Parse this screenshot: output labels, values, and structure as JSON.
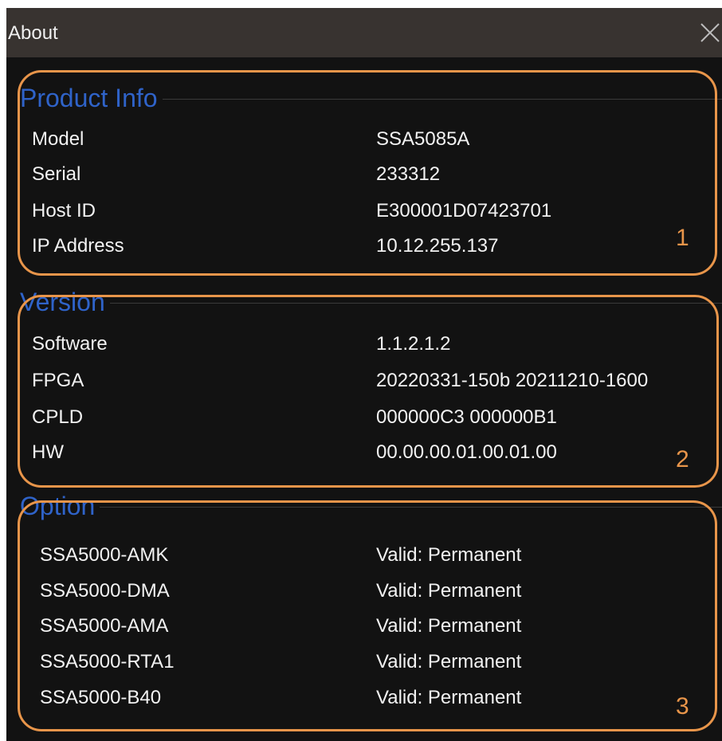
{
  "dialog": {
    "title": "About"
  },
  "sections": {
    "product_info": {
      "label": "Product Info",
      "marker": "1",
      "rows": [
        {
          "key": "Model",
          "value": "SSA5085A"
        },
        {
          "key": "Serial",
          "value": "233312"
        },
        {
          "key": "Host ID",
          "value": "E300001D07423701"
        },
        {
          "key": "IP Address",
          "value": "10.12.255.137"
        }
      ]
    },
    "version": {
      "label": "Version",
      "marker": "2",
      "rows": [
        {
          "key": "Software",
          "value": "1.1.2.1.2"
        },
        {
          "key": "FPGA",
          "value": "20220331-150b  20211210-1600"
        },
        {
          "key": "CPLD",
          "value": "000000C3  000000B1"
        },
        {
          "key": "HW",
          "value": "00.00.00.01.00.01.00"
        }
      ]
    },
    "option": {
      "label": "Option",
      "marker": "3",
      "rows": [
        {
          "key": "SSA5000-AMK",
          "value": "Valid: Permanent"
        },
        {
          "key": "SSA5000-DMA",
          "value": "Valid: Permanent"
        },
        {
          "key": "SSA5000-AMA",
          "value": "Valid: Permanent"
        },
        {
          "key": "SSA5000-RTA1",
          "value": "Valid: Permanent"
        },
        {
          "key": "SSA5000-B40",
          "value": "Valid: Permanent"
        }
      ]
    }
  },
  "colors": {
    "title_bar": "#383330",
    "background": "#121212",
    "section_label": "#2f63c9",
    "annotation": "#e8954a",
    "text": "#f2f2f2"
  },
  "icons": {
    "close": "close-icon"
  }
}
